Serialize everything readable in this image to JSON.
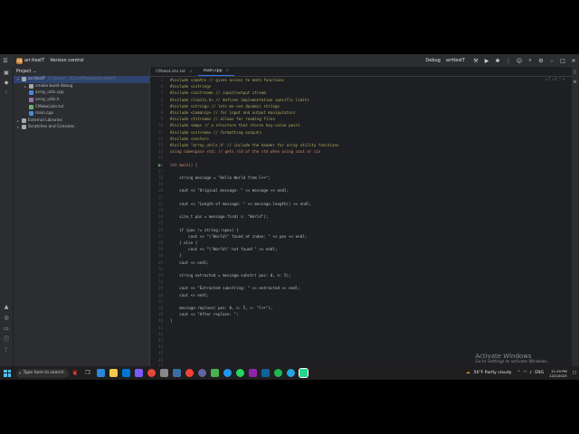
{
  "titlebar": {
    "project_badge": "AB",
    "project_name": "arr.tlestT",
    "vcs": "Version control",
    "config": "Debug",
    "run_target": "arrtlestT"
  },
  "project": {
    "title": "Project",
    "items": [
      {
        "label": "arr.tlestT",
        "detail": "C:\\Users\\...\\CLionProjects\\arr.tlestT",
        "depth": 0,
        "arrow": "▾",
        "color": "#a3a7ae",
        "selected": true
      },
      {
        "label": "cmake-build-debug",
        "detail": "",
        "depth": 1,
        "arrow": "▸",
        "color": "#a3a7ae",
        "selected": false
      },
      {
        "label": "array_utils.cpp",
        "detail": "",
        "depth": 1,
        "arrow": "",
        "color": "#4a8ad8",
        "selected": false
      },
      {
        "label": "array_utils.h",
        "detail": "",
        "depth": 1,
        "arrow": "",
        "color": "#9876aa",
        "selected": false
      },
      {
        "label": "CMakeLists.txt",
        "detail": "",
        "depth": 1,
        "arrow": "",
        "color": "#6aab73",
        "selected": false
      },
      {
        "label": "main.cpp",
        "detail": "",
        "depth": 1,
        "arrow": "",
        "color": "#4a8ad8",
        "selected": false
      },
      {
        "label": "External Libraries",
        "detail": "",
        "depth": 0,
        "arrow": "▸",
        "color": "#a3a7ae",
        "selected": false
      },
      {
        "label": "Scratches and Consoles",
        "detail": "",
        "depth": 0,
        "arrow": "▸",
        "color": "#a3a7ae",
        "selected": false
      }
    ]
  },
  "editor": {
    "tabs": [
      {
        "label": "CMakeLists.txt",
        "active": false
      },
      {
        "label": "main.cpp",
        "active": true
      }
    ],
    "inspection": "⚠7 ⚠1 ^ v",
    "line_numbers": [
      "3",
      "4",
      "5",
      "6",
      "7",
      "8",
      "9",
      "10",
      "11",
      "12",
      "13",
      "14",
      "15",
      "16",
      "17",
      "18",
      "19",
      "20",
      "21",
      "22",
      "23",
      "24",
      "25",
      "26",
      "27",
      "28",
      "29",
      "30",
      "31",
      "32",
      "33",
      "34",
      "35",
      "36",
      "37",
      "38",
      "39",
      "40",
      "41",
      "42",
      "43",
      "44",
      "45",
      "46",
      "47",
      "48",
      "49",
      "50",
      "51",
      "52",
      "53"
    ],
    "code": [
      "#include <cmath> // gives access to math functions",
      "#include <cstring>",
      "#include <iostream> // input/output stream",
      "#include <limits.h> // defines implementation specific limits",
      "#include <string> // lets me use dynamic strings",
      "#include <iomanip> // for input and output manipulators",
      "#include <fstream> // allows for reading files",
      "#include <map> // a structure that stores key-value pairs",
      "#include <sstream> // formatting outputs",
      "#include <vector>",
      "#include \"array_utils.h\" // include the header for array utility functions",
      "using namespace std; // gets rid of the std when using cout or cin",
      "",
      "int main() {",
      "",
      "    string message = \"Hello World from C++\";",
      "",
      "    cout << \"Original message: \" << message << endl;",
      "",
      "    cout << \"Length of message: \" << message.length() << endl;",
      "",
      "    size_t pos = message.find( s: \"World\");",
      "",
      "    if (pos != string::npos) {",
      "        cout << \"\\\"World\\\" found at index: \" << pos << endl;",
      "    } else {",
      "        cout << \"\\\"World\\\" not found \" << endl;",
      "    }",
      "    cout << endl;",
      "",
      "    string extracted = message.substr( pos: 0, n: 5);",
      "",
      "    cout << \"Extracted substring: \" << extracted << endl;",
      "    cout << endl;",
      "",
      "    message.replace( pos: 0, n: 5, s: \"C++\");",
      "    cout << \"After replace: \";",
      "}",
      "",
      "",
      "",
      "",
      "",
      "",
      "",
      "",
      "",
      "",
      "",
      "",
      ""
    ]
  },
  "activate": {
    "title": "Activate Windows",
    "subtitle": "Go to Settings to activate Windows."
  },
  "status": {
    "path": "arr.tlestT > main.cpp",
    "func": "main",
    "lang": "clang-tidy",
    "pos": "37:38",
    "eol": "LF",
    "enc": "UTF-8",
    "indent": "4 spaces",
    "context": "C++: arr.tlestT | Debug"
  },
  "taskbar": {
    "search_placeholder": "Type here to search",
    "weather": "56°F Partly cloudy",
    "lang": "ENG",
    "time": "11:19 PM",
    "date": "12/1/2025"
  }
}
